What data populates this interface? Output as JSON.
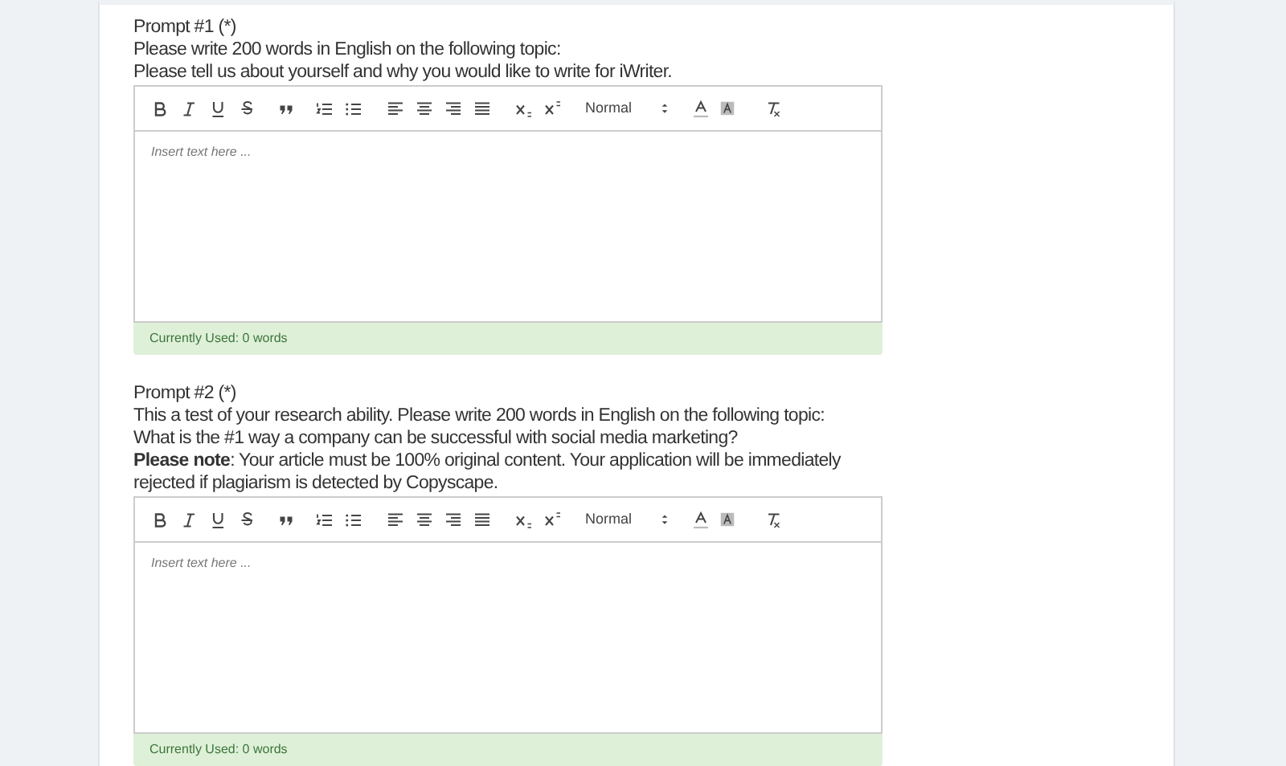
{
  "prompts": [
    {
      "title": "Prompt #1 (*)",
      "lines": [
        "Please write 200 words in English on the following topic:",
        "Please tell us about yourself and why you would like to write for iWriter."
      ],
      "editor": {
        "header_picker": "Normal",
        "placeholder": "Insert text here ..."
      },
      "word_count": "Currently Used: 0 words"
    },
    {
      "title": "Prompt #2 (*)",
      "lines": [
        "This a test of your research ability. Please write 200 words in English on the following topic:",
        "What is the #1 way a company can be successful with social media marketing?",
        "**Please note**: Your article must be 100% original content. Your application will be immediately rejected if plagiarism is detected by Copyscape."
      ],
      "editor": {
        "header_picker": "Normal",
        "placeholder": "Insert text here ..."
      },
      "word_count": "Currently Used: 0 words"
    }
  ]
}
